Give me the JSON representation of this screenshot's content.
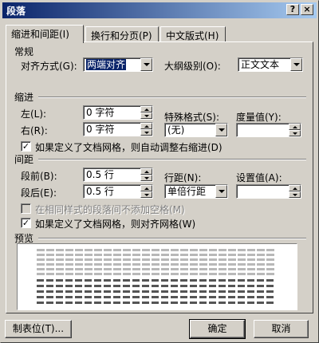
{
  "window": {
    "title": "段落",
    "help_btn": "?",
    "close_btn": "×"
  },
  "tabs": [
    {
      "label": "缩进和间距(I)"
    },
    {
      "label": "换行和分页(P)"
    },
    {
      "label": "中文版式(H)"
    }
  ],
  "general": {
    "section_label": "常规",
    "align_label": "对齐方式(G):",
    "align_value": "两端对齐",
    "outline_label": "大纲级别(O):",
    "outline_value": "正文文本"
  },
  "indent": {
    "section_label": "缩进",
    "left_label": "左(L):",
    "left_value": "0 字符",
    "right_label": "右(R):",
    "right_value": "0 字符",
    "special_label": "特殊格式(S):",
    "special_value": "(无)",
    "by_label": "度量值(Y):",
    "by_value": "",
    "auto_adjust_label": "如果定义了文档网格，则自动调整右缩进(D)",
    "auto_adjust_checked": "✓"
  },
  "spacing": {
    "section_label": "间距",
    "before_label": "段前(B):",
    "before_value": "0.5 行",
    "after_label": "段后(E):",
    "after_value": "0.5 行",
    "line_label": "行距(N):",
    "line_value": "单倍行距",
    "at_label": "设置值(A):",
    "at_value": "",
    "no_space_label": "在相同样式的段落间不添加空格(M)",
    "snap_grid_label": "如果定义了文档网格，则对齐网格(W)",
    "snap_grid_checked": "✓"
  },
  "preview": {
    "section_label": "预览"
  },
  "buttons": {
    "tabs": "制表位(T)...",
    "ok": "确定",
    "cancel": "取消"
  }
}
